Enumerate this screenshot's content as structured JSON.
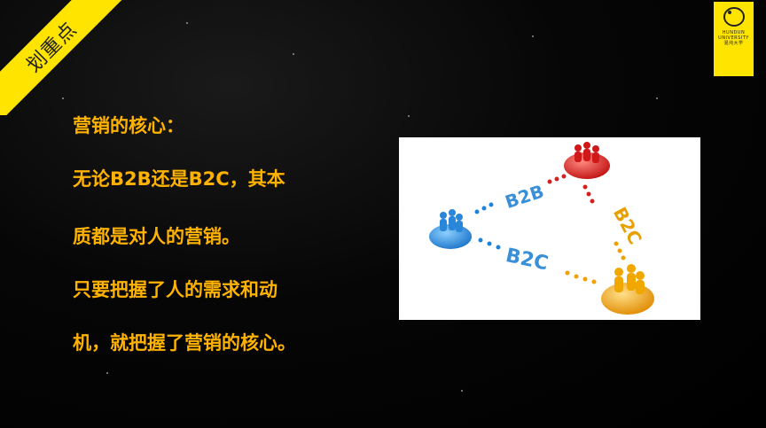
{
  "badge": {
    "label": "划重点"
  },
  "logo": {
    "line1": "HUNDUN",
    "line2": "UNIVERSITY",
    "line3": "混沌大学"
  },
  "content": {
    "lines": [
      "营销的核心：",
      "无论B2B还是B2C，其本",
      "质都是对人的营销。",
      "只要把握了人的需求和动",
      "机，就把握了营销的核心。"
    ]
  },
  "diagram": {
    "edge_labels": {
      "top": "B2B",
      "right": "B2C",
      "bottom": "B2C"
    },
    "node_colors": {
      "left": "#2a8fe0",
      "top": "#e02020",
      "right": "#f2a90a"
    },
    "text_color": "#ffb300",
    "accent_yellow": "#ffe400"
  }
}
